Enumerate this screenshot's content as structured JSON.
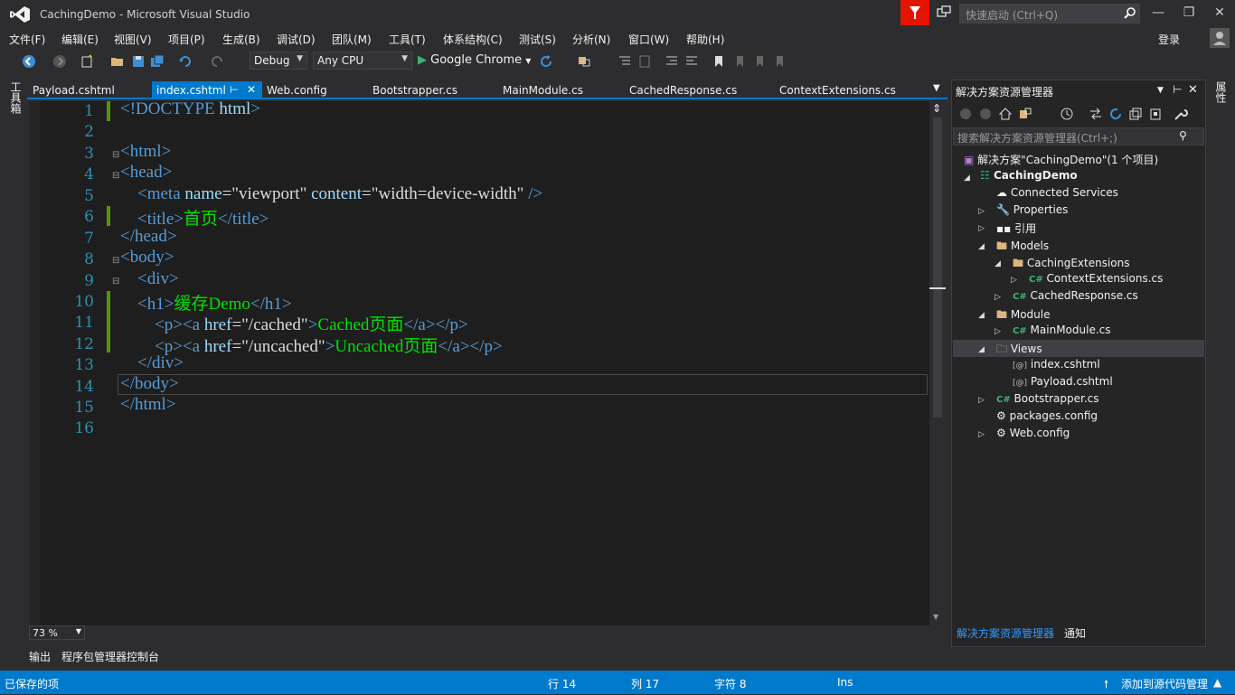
{
  "window": {
    "title": "CachingDemo - Microsoft Visual Studio",
    "quick_launch_placeholder": "快速启动 (Ctrl+Q)",
    "signin": "登录"
  },
  "menu": [
    "文件(F)",
    "编辑(E)",
    "视图(V)",
    "项目(P)",
    "生成(B)",
    "调试(D)",
    "团队(M)",
    "工具(T)",
    "体系结构(C)",
    "测试(S)",
    "分析(N)",
    "窗口(W)",
    "帮助(H)"
  ],
  "toolbar": {
    "config": "Debug",
    "platform": "Any CPU",
    "run_target": "Google Chrome"
  },
  "left_strip_label": "工具箱",
  "right_strip_label": "属性",
  "tabs": {
    "payload": "Payload.cshtml",
    "index": "index.cshtml",
    "webconfig": "Web.config",
    "bootstrapper": "Bootstrapper.cs",
    "mainmodule": "MainModule.cs",
    "cachedresponse": "CachedResponse.cs",
    "contextext": "ContextExtensions.cs"
  },
  "editor": {
    "line_numbers": [
      "1",
      "2",
      "3",
      "4",
      "5",
      "6",
      "7",
      "8",
      "9",
      "10",
      "11",
      "12",
      "13",
      "14",
      "15",
      "16"
    ],
    "zoom": "73 %",
    "l1": {
      "a": "<!DOCTYPE ",
      "b": "html",
      "c": ">"
    },
    "l3": {
      "a": "<",
      "b": "html",
      "c": ">"
    },
    "l4": {
      "a": "<",
      "b": "head",
      "c": ">"
    },
    "l5": {
      "a": "<",
      "b": "meta",
      "c": " name",
      "d": "=\"viewport\"",
      "e": " content",
      "f": "=\"width=device-width\"",
      "g": " />"
    },
    "l6": {
      "a": "<",
      "b": "title",
      "c": ">",
      "d": "首页",
      "e": "</",
      "f": "title",
      "g": ">"
    },
    "l7": {
      "a": "</",
      "b": "head",
      "c": ">"
    },
    "l8": {
      "a": "<",
      "b": "body",
      "c": ">"
    },
    "l9": {
      "a": "<",
      "b": "div",
      "c": ">"
    },
    "l10": {
      "a": "<",
      "b": "h1",
      "c": ">",
      "d": "缓存Demo",
      "e": "</",
      "f": "h1",
      "g": ">"
    },
    "l11": {
      "a": "<",
      "b": "p",
      "c": "><",
      "d": "a",
      "e": " href",
      "f": "=\"/cached\"",
      "g": ">",
      "h": "Cached页面",
      "i": "</",
      "j": "a",
      "k": "></",
      "l": "p",
      "m": ">"
    },
    "l12": {
      "a": "<",
      "b": "p",
      "c": "><",
      "d": "a",
      "e": " href",
      "f": "=\"/uncached\"",
      "g": ">",
      "h": "Uncached页面",
      "i": "</",
      "j": "a",
      "k": "></",
      "l": "p",
      "m": ">"
    },
    "l13": {
      "a": "</",
      "b": "div",
      "c": ">"
    },
    "l14": {
      "a": "</",
      "b": "body",
      "c": ">"
    },
    "l15": {
      "a": "</",
      "b": "html",
      "c": ">"
    }
  },
  "solution_explorer": {
    "title": "解决方案资源管理器",
    "search_placeholder": "搜索解决方案资源管理器(Ctrl+;)",
    "solution": "解决方案\"CachingDemo\"(1 个项目)",
    "project": "CachingDemo",
    "items": {
      "connected": "Connected Services",
      "properties": "Properties",
      "refs": "引用",
      "models": "Models",
      "cachingext": "CachingExtensions",
      "contextext": "ContextExtensions.cs",
      "cachedresp": "CachedResponse.cs",
      "module": "Module",
      "mainmodule": "MainModule.cs",
      "views": "Views",
      "index": "index.cshtml",
      "payload": "Payload.cshtml",
      "bootstrapper": "Bootstrapper.cs",
      "packages": "packages.config",
      "webconfig": "Web.config"
    },
    "bottom_tab_active": "解决方案资源管理器",
    "bottom_tab_other": "通知"
  },
  "bottom_tabs": [
    "输出",
    "程序包管理器控制台"
  ],
  "status": {
    "left": "已保存的项",
    "line": "行 14",
    "col": "列 17",
    "char": "字符 8",
    "mode": "Ins",
    "source_control": "添加到源代码管理"
  },
  "colors": {
    "accent": "#007acc",
    "flag": "#e51400",
    "tag": "#569cd6",
    "attr": "#9cdcfe",
    "text": "#00e000",
    "line_number": "#2b91af",
    "change_marker": "#4e9a06"
  }
}
